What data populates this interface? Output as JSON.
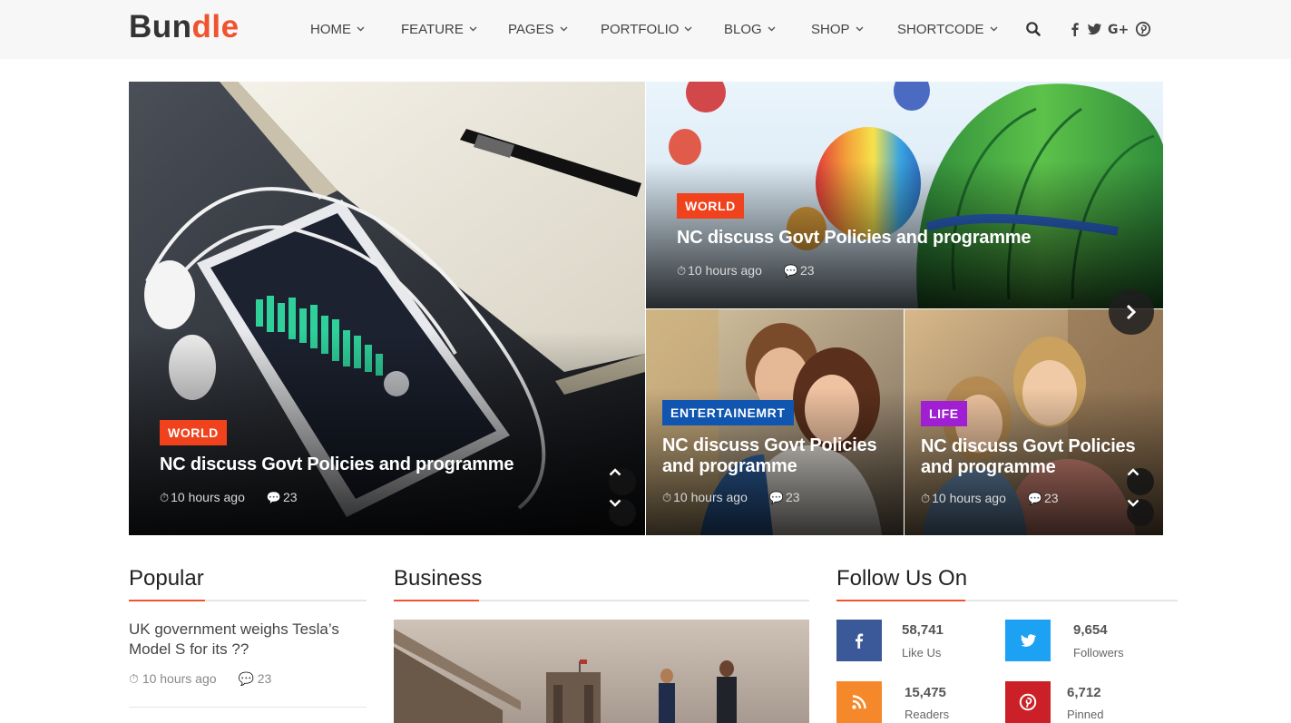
{
  "brand": {
    "logo_a": "Bun",
    "logo_b": "dle"
  },
  "nav": [
    {
      "label": "HOME"
    },
    {
      "label": "FEATURE"
    },
    {
      "label": "PAGES"
    },
    {
      "label": "PORTFOLIO"
    },
    {
      "label": "BLOG"
    },
    {
      "label": "SHOP"
    },
    {
      "label": "SHORTCODE"
    }
  ],
  "header_icons": [
    "search-icon",
    "facebook-icon",
    "twitter-icon",
    "google-plus-icon",
    "pinterest-icon"
  ],
  "hero": {
    "main": {
      "tag": "WORLD",
      "title": "NC discuss Govt Policies and programme",
      "time": "10 hours ago",
      "comments": "23"
    },
    "top_right": {
      "tag": "WORLD",
      "title": "NC discuss Govt Policies and programme",
      "time": "10 hours ago",
      "comments": "23"
    },
    "bottom_left": {
      "tag": "ENTERTAINEMRT",
      "title": "NC discuss Govt Policies and programme",
      "time": "10 hours ago",
      "comments": "23"
    },
    "bottom_right": {
      "tag": "LIFE",
      "title": "NC discuss Govt Policies and programme",
      "time": "10 hours ago",
      "comments": "23"
    }
  },
  "sections": {
    "popular": {
      "title": "Popular",
      "items": [
        {
          "title": "UK government weighs Tesla’s Model S for its ??",
          "time": "10 hours ago",
          "comments": "23"
        }
      ]
    },
    "business": {
      "title": "Business"
    },
    "follow": {
      "title": "Follow Us On",
      "items": [
        {
          "network": "facebook",
          "count": "58,741",
          "label": "Like Us",
          "color": "#3b5998"
        },
        {
          "network": "twitter",
          "count": "9,654",
          "label": "Followers",
          "color": "#1da1f2"
        },
        {
          "network": "rss",
          "count": "15,475",
          "label": "Readers",
          "color": "#f5882a"
        },
        {
          "network": "pinterest",
          "count": "6,712",
          "label": "Pinned",
          "color": "#cb2027"
        }
      ]
    }
  },
  "colors": {
    "accent": "#f0532f",
    "tag_world": "#f0421d",
    "tag_entertainment": "#1055b0",
    "tag_life": "#a11fd3"
  }
}
